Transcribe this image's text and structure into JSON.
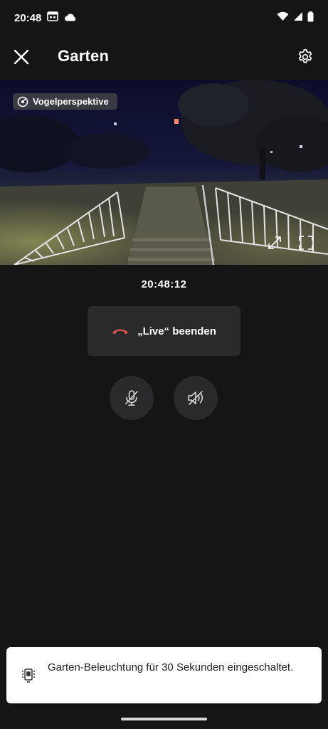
{
  "status_bar": {
    "time": "20:48"
  },
  "app_bar": {
    "title": "Garten"
  },
  "video": {
    "badge_label": "Vogelperspektive"
  },
  "live": {
    "timestamp": "20:48:12",
    "end_button_label": "„Live“ beenden"
  },
  "toast": {
    "message": "Garten-Beleuchtung für 30 Sekunden eingeschaltet."
  },
  "colors": {
    "background": "#151515",
    "button_bg": "#2a2a2d",
    "hangup_red": "#e0524a",
    "toast_bg": "#ffffff"
  }
}
